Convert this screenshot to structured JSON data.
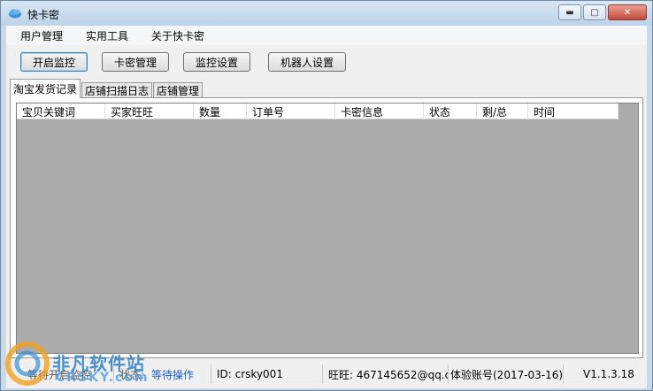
{
  "window": {
    "title": "快卡密",
    "minimize": "▬",
    "maximize": "▢",
    "close": "✕"
  },
  "menu": [
    {
      "label": "用户管理"
    },
    {
      "label": "实用工具"
    },
    {
      "label": "关于快卡密"
    }
  ],
  "toolbar": {
    "start_monitor": "开启监控",
    "card_manage": "卡密管理",
    "monitor_settings": "监控设置",
    "robot_settings": "机器人设置"
  },
  "tabs": [
    {
      "label": "淘宝发货记录"
    },
    {
      "label": "店铺扫描日志"
    },
    {
      "label": "店铺管理"
    }
  ],
  "grid": {
    "columns": [
      "宝贝关键词",
      "买家旺旺",
      "数量",
      "订单号",
      "卡密信息",
      "状态",
      "剩/总",
      "时间"
    ]
  },
  "status": {
    "monitor": "等待开启监控",
    "state_label": "状态:",
    "state_value": "等待操作",
    "id": "ID:  crsky001",
    "wangwang": "旺旺:  467145652@qq.com",
    "account": "体验账号(2017-03-16)",
    "version": "V1.1.3.18"
  },
  "watermark": {
    "line1": "非凡软件站",
    "line2": "CRSKY.com"
  },
  "colors": {
    "grid_bg": "#ababab",
    "titlebar": "#c8daea",
    "status_accent": "#1a5fc4"
  }
}
